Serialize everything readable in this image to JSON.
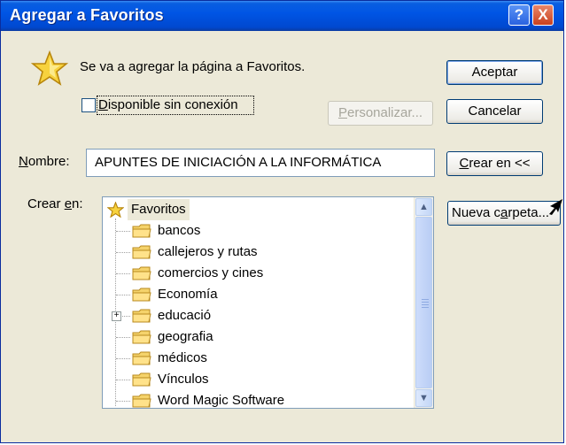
{
  "window": {
    "title": "Agregar a Favoritos",
    "help_glyph": "?",
    "close_glyph": "X"
  },
  "message": "Se va a agregar la página a Favoritos.",
  "offline_checkbox": {
    "label_rest": "isponible sin conexión",
    "mnemonic": "D",
    "checked": false
  },
  "buttons": {
    "ok": "Aceptar",
    "cancel": "Cancelar",
    "customize_rest": "ersonalizar...",
    "customize_mnemonic": "P",
    "create_in_rest": "rear en <<",
    "create_in_mnemonic": "C",
    "new_folder_prefix": "Nueva c",
    "new_folder_mnemonic": "a",
    "new_folder_suffix": "rpeta..."
  },
  "name_field": {
    "label_rest": "ombre:",
    "label_mnemonic": "N",
    "value": "APUNTES DE INICIACIÓN A LA INFORMÁTICA"
  },
  "create_in": {
    "label_prefix": "Crear ",
    "label_mnemonic": "e",
    "label_suffix": "n:"
  },
  "tree": {
    "root": "Favoritos",
    "items": [
      {
        "label": "bancos",
        "expandable": false
      },
      {
        "label": "callejeros y rutas",
        "expandable": false
      },
      {
        "label": "comercios y cines",
        "expandable": false
      },
      {
        "label": "Economía",
        "expandable": false
      },
      {
        "label": "educació",
        "expandable": true
      },
      {
        "label": "geografia",
        "expandable": false
      },
      {
        "label": "médicos",
        "expandable": false
      },
      {
        "label": "Vínculos",
        "expandable": false
      },
      {
        "label": "Word Magic Software",
        "expandable": false
      }
    ],
    "scroll_up_glyph": "▲",
    "scroll_down_glyph": "▼"
  },
  "colors": {
    "titlebar": "#0055e5",
    "dialog_bg": "#ece9d8",
    "root_highlight": "#ece9d8"
  }
}
